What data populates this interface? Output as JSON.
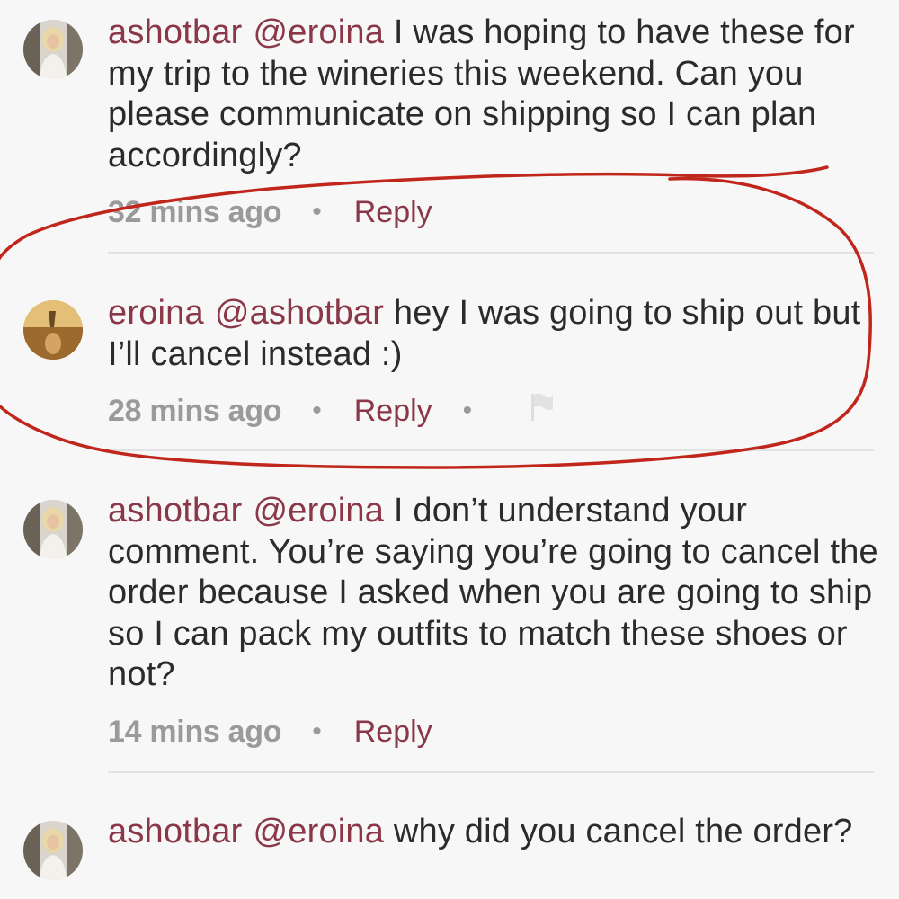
{
  "comments": [
    {
      "username": "ashotbar",
      "mention": "@eroina",
      "text": "I was hoping to have these for my trip to the wineries this weekend. Can you please communicate on shipping so I can plan accordingly?",
      "time": "32 mins ago",
      "reply_label": "Reply",
      "avatar_icon": "user-avatar-blonde-woman"
    },
    {
      "username": "eroina",
      "mention": "@ashotbar",
      "text": "hey I was going to ship out but I’ll cancel instead :)",
      "time": "28 mins ago",
      "reply_label": "Reply",
      "avatar_icon": "user-avatar-sunset",
      "flag_icon": "flag-icon"
    },
    {
      "username": "ashotbar",
      "mention": "@eroina",
      "text": "I don’t understand your comment. You’re saying you’re going to cancel the order because I asked when you are going to ship so I can pack my outfits to match these shoes or not?",
      "time": "14 mins ago",
      "reply_label": "Reply",
      "avatar_icon": "user-avatar-blonde-woman"
    },
    {
      "username": "ashotbar",
      "mention": "@eroina",
      "text": "why did you cancel the order?",
      "avatar_icon": "user-avatar-blonde-woman"
    }
  ],
  "separator": "•",
  "colors": {
    "username": "#8a3747",
    "text": "#2b2b2b",
    "meta": "#9a9a9a",
    "annotation": "#c0261c"
  }
}
